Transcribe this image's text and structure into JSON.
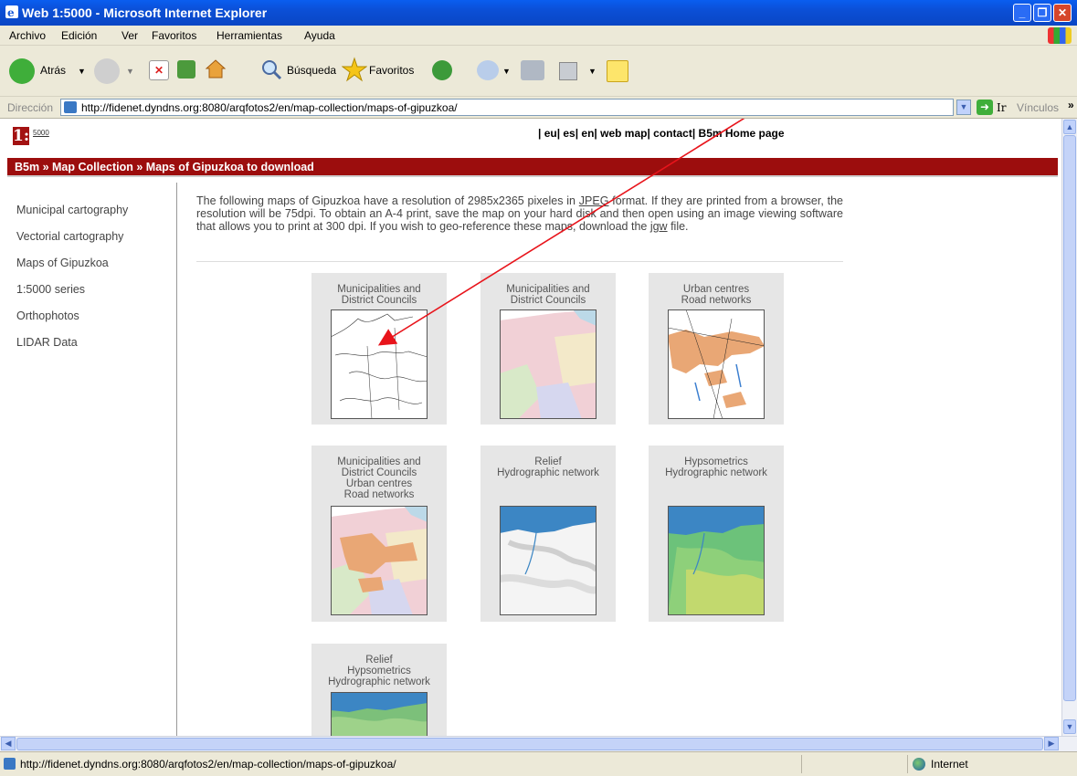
{
  "window": {
    "title": "Web 1:5000 - Microsoft Internet Explorer"
  },
  "menu": [
    "Archivo",
    "Edición",
    "Ver",
    "Favoritos",
    "Herramientas",
    "Ayuda"
  ],
  "toolbar": {
    "back_label": "Atrás",
    "search_label": "Búsqueda",
    "favorites_label": "Favoritos"
  },
  "address": {
    "label": "Dirección",
    "url": "http://fidenet.dyndns.org:8080/arqfotos2/en/map-collection/maps-of-gipuzkoa/",
    "go_label": "Ir",
    "links_label": "Vínculos"
  },
  "page": {
    "logo_big": "1:",
    "logo_small": "5000",
    "toplinks": "| eu| es| en| web map| contact| B5m Home page",
    "breadcrumb": "B5m » Map Collection » Maps of Gipuzkoa to download",
    "sidebar": [
      "Municipal cartography",
      "Vectorial cartography",
      "Maps of Gipuzkoa",
      "1:5000 series",
      "Orthophotos",
      "LIDAR Data"
    ],
    "intro_before_jpeg": "The following maps of Gipuzkoa have a resolution of 2985x2365 pixeles in ",
    "intro_jpeg": "JPEG",
    "intro_middle": " format. If they are printed from a browser, the resolution will be 75dpi. To obtain an A-4 print, save the map on your hard disk and then open using an image viewing software that allows you to print at 300 dpi. If you wish to geo-reference these maps, download the ",
    "intro_jgw": "jgw",
    "intro_after": " file.",
    "cards": [
      {
        "lines": [
          "Municipalities and",
          "District Councils"
        ],
        "style": "outline"
      },
      {
        "lines": [
          "Municipalities and",
          "District Councils"
        ],
        "style": "pastel"
      },
      {
        "lines": [
          "Urban centres",
          "Road networks"
        ],
        "style": "urban"
      },
      {
        "lines": [
          "Municipalities and",
          "District Councils",
          "Urban centres",
          "Road networks"
        ],
        "style": "combined"
      },
      {
        "lines": [
          "Relief",
          "Hydrographic network"
        ],
        "style": "relief"
      },
      {
        "lines": [
          "Hypsometrics",
          "Hydrographic network"
        ],
        "style": "hypso"
      },
      {
        "lines": [
          "Relief",
          "Hypsometrics",
          "Hydrographic network"
        ],
        "style": "relief-hypso"
      }
    ]
  },
  "status": {
    "url": "http://fidenet.dyndns.org:8080/arqfotos2/en/map-collection/maps-of-gipuzkoa/",
    "zone": "Internet"
  },
  "colors": {
    "breadcrumb_bg": "#9c0d0d",
    "annotation_arrow": "#e8141b"
  }
}
